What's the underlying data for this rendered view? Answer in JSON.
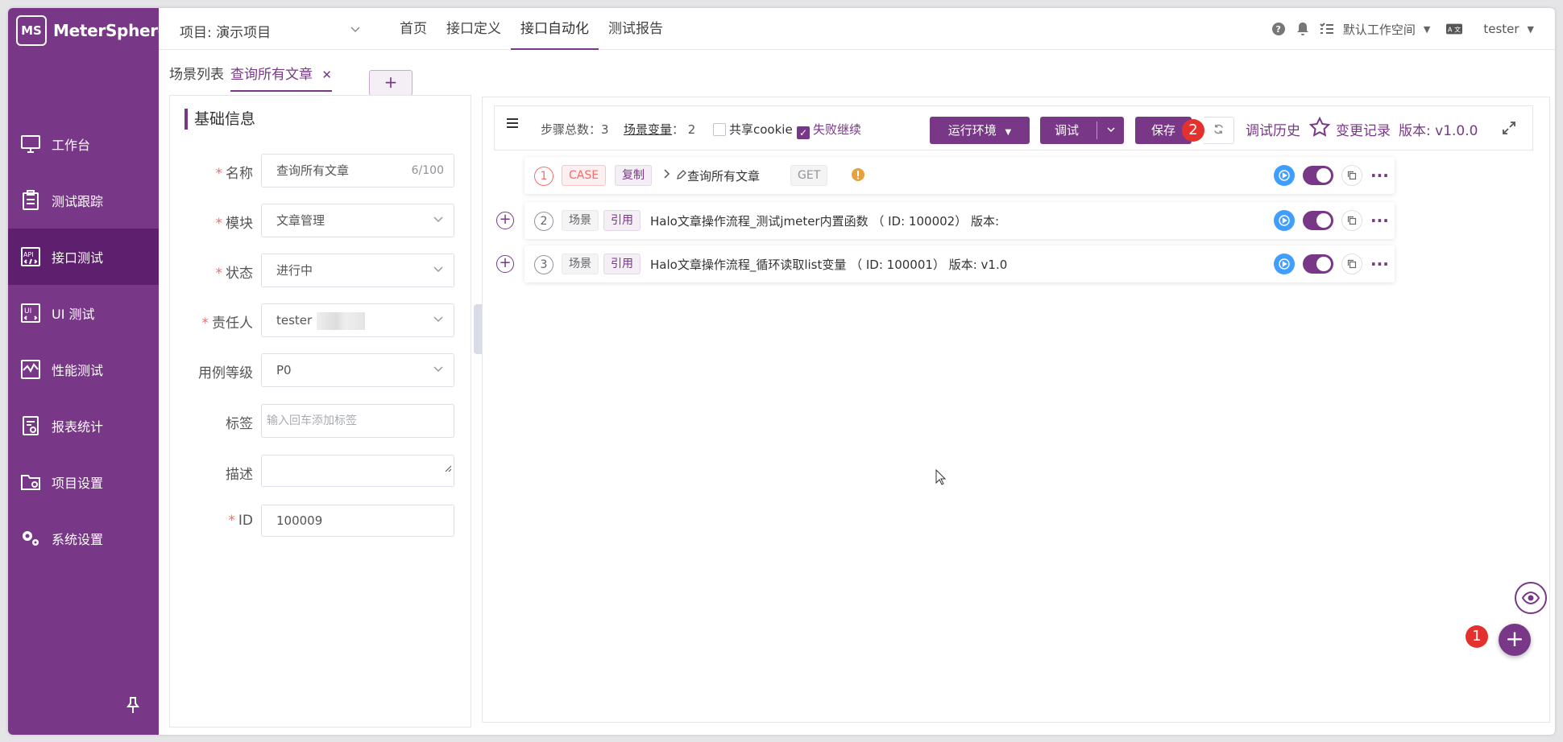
{
  "brand": {
    "name": "MeterSphere",
    "logo": "MS"
  },
  "sidebar": {
    "items": [
      {
        "label": "工作台",
        "icon": "monitor-icon"
      },
      {
        "label": "测试跟踪",
        "icon": "clipboard-icon"
      },
      {
        "label": "接口测试",
        "icon": "api-icon",
        "active": true
      },
      {
        "label": "UI 测试",
        "icon": "ui-test-icon"
      },
      {
        "label": "性能测试",
        "icon": "performance-icon"
      },
      {
        "label": "报表统计",
        "icon": "report-icon"
      },
      {
        "label": "项目设置",
        "icon": "folder-icon"
      },
      {
        "label": "系统设置",
        "icon": "gears-icon"
      }
    ]
  },
  "header": {
    "project": "项目: 演示项目",
    "nav": [
      "首页",
      "接口定义",
      "接口自动化",
      "测试报告"
    ],
    "active_nav": "接口自动化",
    "workspace": "默认工作空间",
    "user": "tester"
  },
  "tabs": {
    "list": "场景列表",
    "current": "查询所有文章",
    "add": "+"
  },
  "form": {
    "title": "基础信息",
    "name_label": "名称",
    "name_value": "查询所有文章",
    "name_count": "6/100",
    "module_label": "模块",
    "module_value": "文章管理",
    "status_label": "状态",
    "status_value": "进行中",
    "owner_label": "责任人",
    "owner_value": "tester",
    "level_label": "用例等级",
    "level_value": "P0",
    "tag_label": "标签",
    "tag_placeholder": "输入回车添加标签",
    "desc_label": "描述",
    "id_label": "ID",
    "id_value": "100009"
  },
  "toolbar": {
    "steps_label": "步骤总数：",
    "steps_count": "3",
    "vars_label": "场景变量",
    "vars_count": "：  2",
    "share_cookie": "共享cookie",
    "continue_on_fail": "失败继续",
    "env_button": "运行环境",
    "debug_button": "调试",
    "save_button": "保存",
    "history": "调试历史",
    "changelog": "变更记录",
    "version": "版本: v1.0.0"
  },
  "badges": {
    "save": "2",
    "fab": "1"
  },
  "steps": [
    {
      "num": "1",
      "type": "CASE",
      "ref": "复制",
      "title": "查询所有文章",
      "method": "GET"
    },
    {
      "num": "2",
      "type": "场景",
      "ref": "引用",
      "title": "Halo文章操作流程_测试jmeter内置函数 （ ID: 100002） 版本:"
    },
    {
      "num": "3",
      "type": "场景",
      "ref": "引用",
      "title": "Halo文章操作流程_循环读取list变量 （ ID: 100001） 版本: v1.0"
    }
  ],
  "colors": {
    "brand": "#783887",
    "sidebar_active": "#5e1f6e",
    "play": "#409eff",
    "badge": "#e5312d"
  }
}
